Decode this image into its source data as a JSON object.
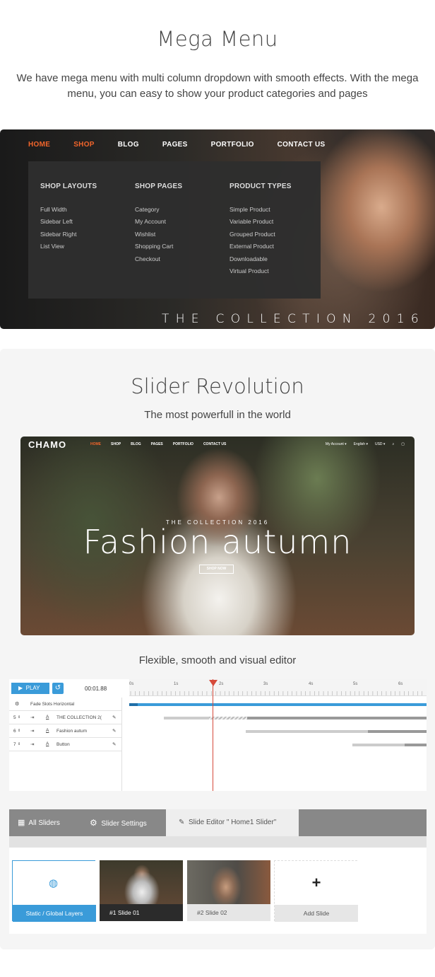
{
  "mega": {
    "title": "Mega Menu",
    "description": "We have mega menu with multi column dropdown with smooth effects. With the mega menu, you can easy to show your product categories and pages",
    "nav": [
      "HOME",
      "SHOP",
      "BLOG",
      "PAGES",
      "PORTFOLIO",
      "CONTACT US"
    ],
    "columns": [
      {
        "heading": "SHOP LAYOUTS",
        "items": [
          "Full Width",
          "Sidebar Left",
          "Sidebar Right",
          "List View"
        ]
      },
      {
        "heading": "SHOP PAGES",
        "items": [
          "Category",
          "My Account",
          "Wishlist",
          "Shopping Cart",
          "Checkout"
        ]
      },
      {
        "heading": "PRODUCT TYPES",
        "items": [
          "Simple Product",
          "Variable Product",
          "Grouped Product",
          "External Product",
          "Downloadable",
          "Virtual Product"
        ]
      }
    ],
    "collection": "THE COLLECTION 2016"
  },
  "slider": {
    "title": "Slider Revolution",
    "subtitle": "The most powerfull in the world",
    "hero": {
      "logo": "CHAMO",
      "nav": [
        "HOME",
        "SHOP",
        "BLOG",
        "PAGES",
        "PORTFOLIO",
        "CONTACT US"
      ],
      "right": [
        "My Account ▾",
        "English ▾",
        "USD ▾",
        "⌕",
        "▢"
      ],
      "collection": "THE COLLECTION 2016",
      "headline": "Fashion autumn",
      "button": "SHOP NOW"
    },
    "editor_caption": "Flexible, smooth and visual editor",
    "editor": {
      "play": "PLAY",
      "time": "00:01.88",
      "ticks": [
        "0s",
        "1s",
        "2s",
        "3s",
        "4s",
        "5s",
        "6s"
      ],
      "rows": [
        {
          "num": "",
          "label": "Fade Slots Horizontal"
        },
        {
          "num": "5",
          "label": "THE COLLECTION 2("
        },
        {
          "num": "6",
          "label": "Fashion autum"
        },
        {
          "num": "7",
          "label": "Button"
        }
      ]
    },
    "tabs": {
      "all": "All Sliders",
      "settings": "Slider Settings",
      "editor": "Slide Editor \" Home1 Slider\""
    },
    "slides": [
      "Static / Global Layers",
      "#1 Slide 01",
      "#2 Slide 02",
      "Add Slide"
    ],
    "accent": "#3a9bd9",
    "brand": "#f2652b"
  }
}
